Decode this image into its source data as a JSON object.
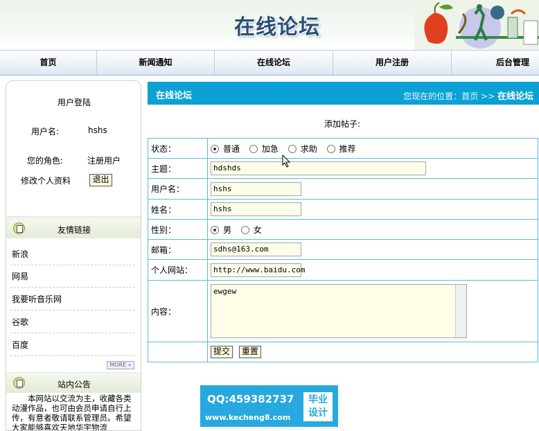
{
  "header": {
    "title": "在线论坛"
  },
  "nav": {
    "items": [
      "首页",
      "新闻通知",
      "在线论坛",
      "用户注册",
      "后台管理"
    ]
  },
  "sidebar": {
    "login": {
      "title": "用户登陆",
      "username_label": "用户名:",
      "username_value": "hshs",
      "role_label": "您的角色:",
      "role_value": "注册用户",
      "edit_profile": "修改个人资料",
      "logout": "退出"
    },
    "links_title": "友情链接",
    "links": [
      "新浪",
      "网易",
      "我要听音乐网",
      "谷歌",
      "百度"
    ],
    "more": "MORE »",
    "notice_title": "站内公告",
    "notice_text": "本网站以交流为主，收藏各类动漫作品，也可由会员申请自行上传，有意者敬请联系管理员。希望大家能够喜欢天地华宇物流"
  },
  "content": {
    "title": "在线论坛",
    "breadcrumb_prefix": "您现在的位置：首页 >>",
    "breadcrumb_current": "在线论坛",
    "caption": "添加帖子:"
  },
  "form": {
    "status_label": "状态：",
    "status_options": [
      "普通",
      "加急",
      "求助",
      "推荐"
    ],
    "status_selected": "普通",
    "subject_label": "主题：",
    "subject_value": "hdshds",
    "username_label": "用户名：",
    "username_value": "hshs",
    "name_label": "姓名：",
    "name_value": "hshs",
    "gender_label": "性别：",
    "gender_options": [
      "男",
      "女"
    ],
    "gender_selected": "男",
    "email_label": "邮箱：",
    "email_value": "sdhs@163.com",
    "website_label": "个人网站：",
    "website_value": "http://www.baidu.com",
    "content_label": "内容：",
    "content_value": "ewgew",
    "submit": "提交",
    "reset": "重置"
  },
  "watermark": {
    "qq": "QQ:459382737",
    "url": "www.kecheng8.com",
    "badge_line1": "毕业",
    "badge_line2": "设计"
  }
}
